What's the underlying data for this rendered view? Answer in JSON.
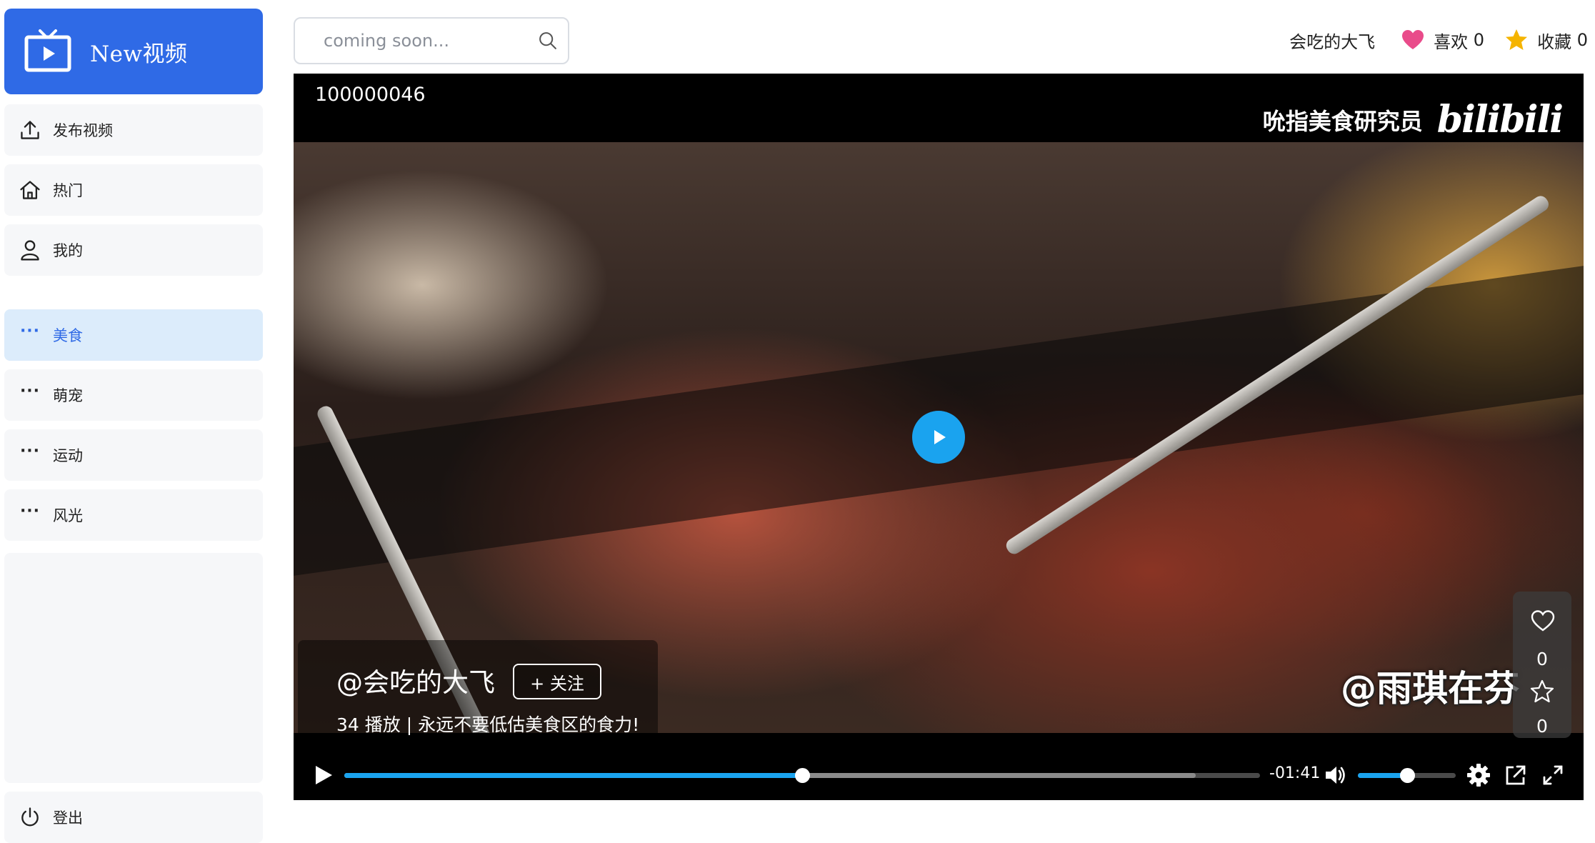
{
  "app": {
    "name": "New视频"
  },
  "sidebar": {
    "main_items": [
      {
        "label": "发布视频",
        "icon": "upload-icon"
      },
      {
        "label": "热门",
        "icon": "home-icon"
      },
      {
        "label": "我的",
        "icon": "user-icon"
      }
    ],
    "categories": [
      {
        "label": "美食",
        "active": true
      },
      {
        "label": "萌宠",
        "active": false
      },
      {
        "label": "运动",
        "active": false
      },
      {
        "label": "风光",
        "active": false
      }
    ],
    "logout": {
      "label": "登出",
      "icon": "power-icon"
    }
  },
  "search": {
    "placeholder": "coming soon...",
    "value": ""
  },
  "header": {
    "username": "会吃的大飞",
    "likes_label": "喜欢",
    "likes_count": "0",
    "favorites_label": "收藏",
    "favorites_count": "0"
  },
  "player": {
    "video_id": "100000046",
    "watermark_text": "吮指美食研究员",
    "watermark_brand": "bilibili",
    "burned_subtitle": "@雨琪在芬",
    "author": "@会吃的大飞",
    "follow_label": "+ 关注",
    "description": "34 播放 | 永远不要低估美食区的食力!",
    "side_like_count": "0",
    "side_fav_count": "0",
    "time_remaining": "-01:41",
    "progress_played": 0.5,
    "progress_buffered": 0.93,
    "volume_level": 0.5
  },
  "colors": {
    "accent": "#2f6ae6",
    "player_accent": "#1aa3ef",
    "heart": "#e94b8a",
    "star": "#f5b400",
    "active_bg": "#dcecfb"
  }
}
